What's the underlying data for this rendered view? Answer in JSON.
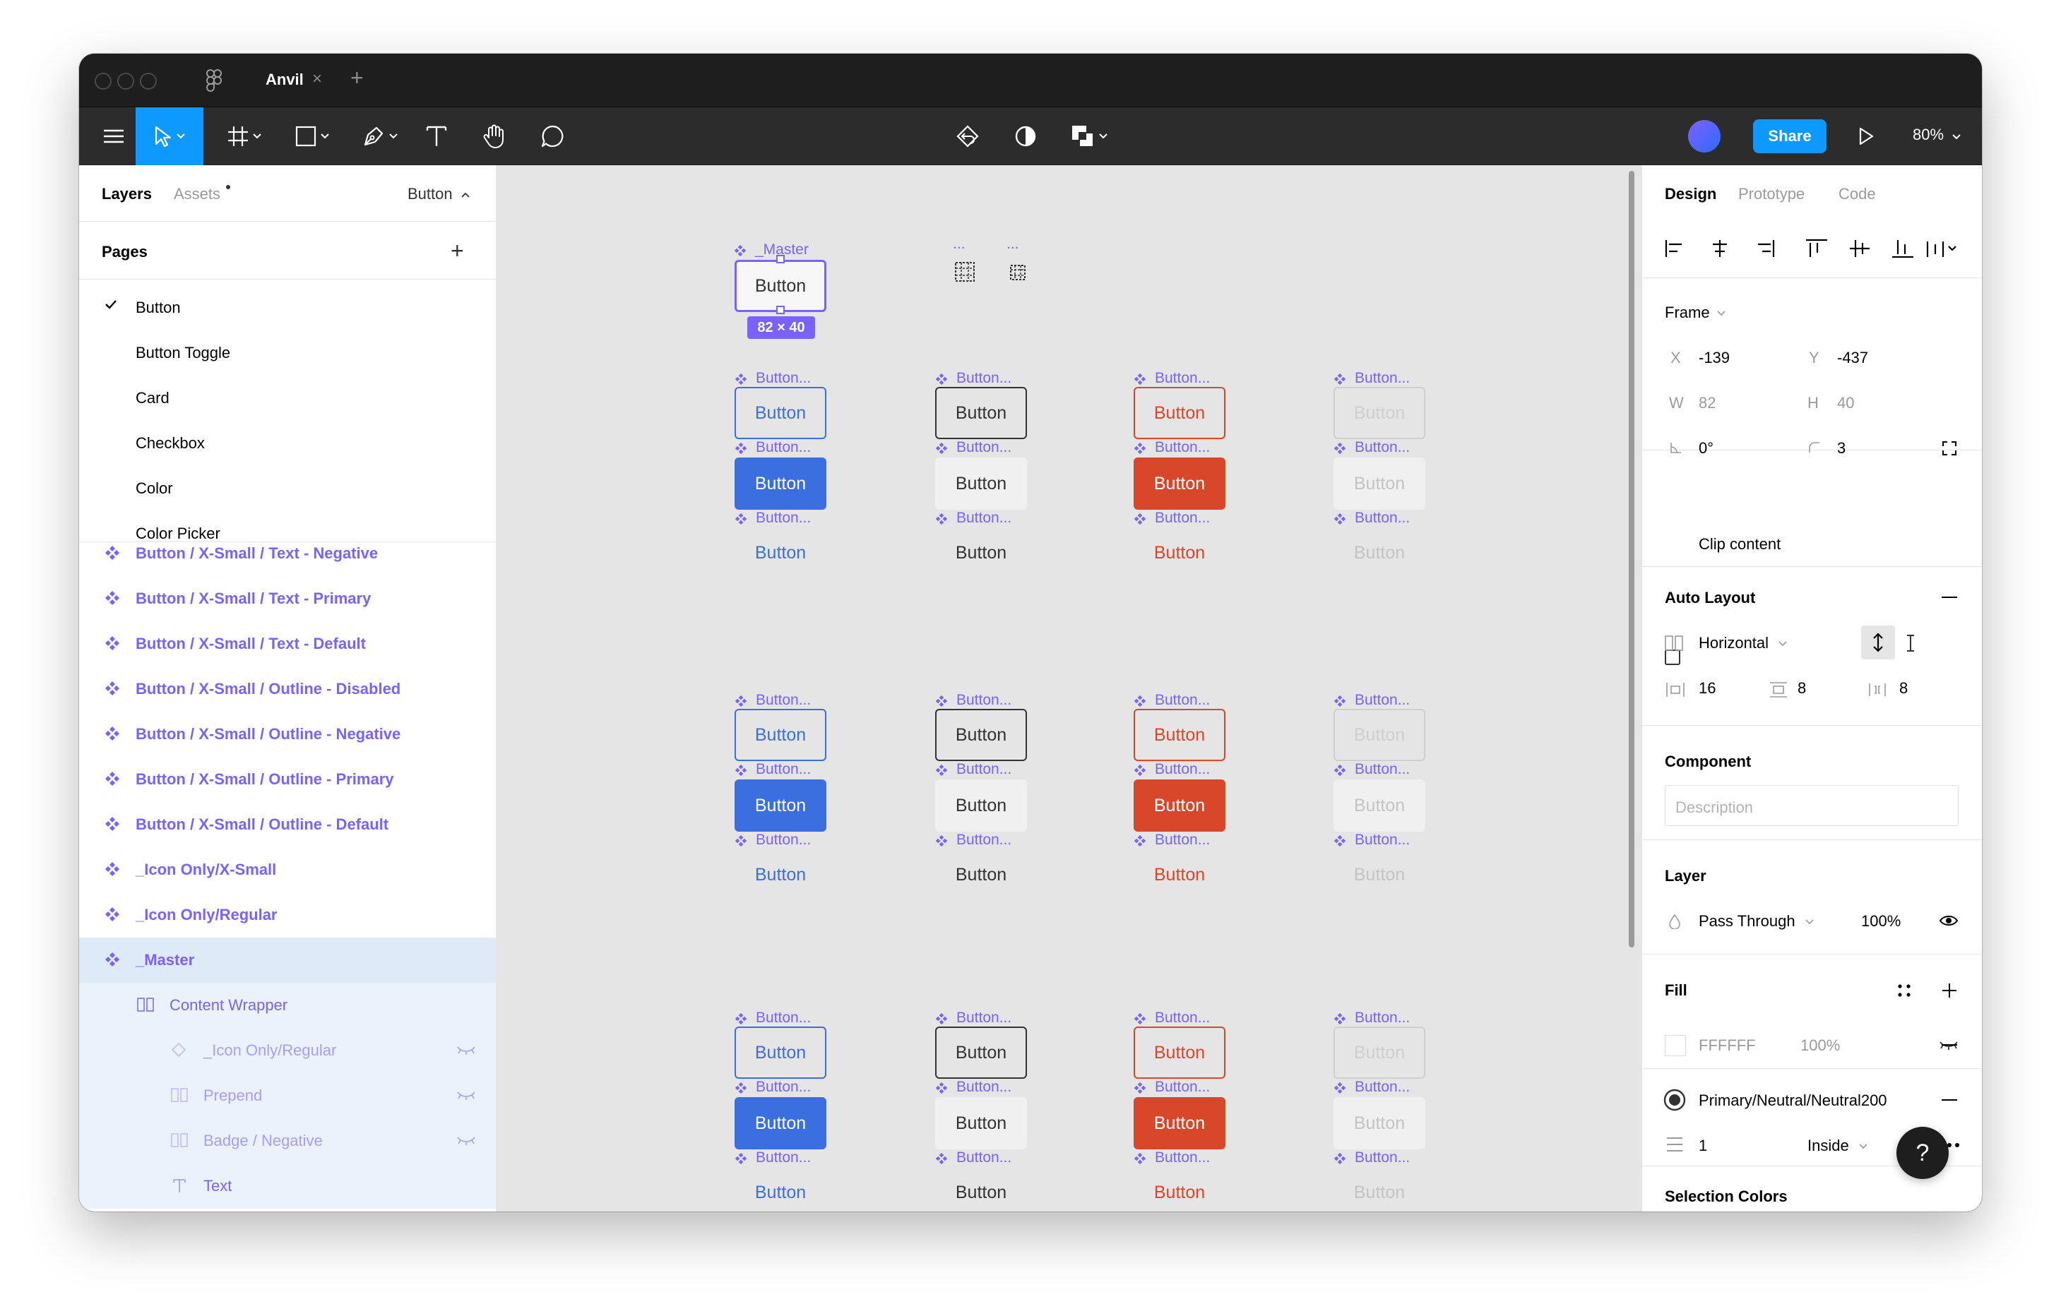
{
  "window": {
    "tab_title": "Anvil",
    "tab_close": "×",
    "new_tab": "+"
  },
  "toolbar": {
    "share_label": "Share",
    "zoom": "80%",
    "icons": [
      "menu-icon",
      "move-icon",
      "frame-icon",
      "rectangle-icon",
      "pen-icon",
      "text-icon",
      "hand-icon",
      "comment-icon",
      "component-icon",
      "contrast-icon",
      "boolean-icon",
      "play-icon"
    ]
  },
  "left_panel": {
    "tab_layers": "Layers",
    "tab_assets": "Assets",
    "current_page": "Button",
    "pages_title": "Pages",
    "pages": [
      "Button",
      "Button Toggle",
      "Card",
      "Checkbox",
      "Color",
      "Color Picker"
    ],
    "selected_page": "Button",
    "layers": [
      {
        "name": "Button / X-Small / Text - Negative",
        "kind": "component"
      },
      {
        "name": "Button / X-Small / Text - Primary",
        "kind": "component"
      },
      {
        "name": "Button / X-Small / Text - Default",
        "kind": "component"
      },
      {
        "name": "Button / X-Small / Outline - Disabled",
        "kind": "component"
      },
      {
        "name": "Button / X-Small / Outline - Negative",
        "kind": "component"
      },
      {
        "name": "Button / X-Small / Outline - Primary",
        "kind": "component"
      },
      {
        "name": "Button / X-Small / Outline - Default",
        "kind": "component"
      },
      {
        "name": "_Icon Only/X-Small",
        "kind": "component"
      },
      {
        "name": "_Icon Only/Regular",
        "kind": "component"
      },
      {
        "name": "_Master",
        "kind": "component-selected"
      },
      {
        "name": "Content Wrapper",
        "kind": "frame-child"
      },
      {
        "name": "_Icon Only/Regular",
        "kind": "instance-hidden"
      },
      {
        "name": "Prepend",
        "kind": "frame-hidden"
      },
      {
        "name": "Badge / Negative",
        "kind": "frame-hidden"
      },
      {
        "name": "Text",
        "kind": "text-child"
      }
    ]
  },
  "canvas": {
    "master_label": "_Master",
    "master_button": "Button",
    "size_badge": "82 × 40",
    "dots": "...",
    "truncated_label": "Button...",
    "button_text": "Button",
    "colors": {
      "primary": "#3b6fe0",
      "neutral": "#333333",
      "negative": "#d9472b",
      "disabled": "#c4c4c4",
      "purple": "#7b61ff"
    }
  },
  "right_panel": {
    "tab_design": "Design",
    "tab_prototype": "Prototype",
    "tab_code": "Code",
    "frame_label": "Frame",
    "x_label": "X",
    "x_value": "-139",
    "y_label": "Y",
    "y_value": "-437",
    "w_label": "W",
    "w_value": "82",
    "h_label": "H",
    "h_value": "40",
    "rotation": "0°",
    "radius": "3",
    "clip_content": "Clip content",
    "auto_layout": "Auto Layout",
    "direction": "Horizontal",
    "padding_h": "16",
    "padding_v": "8",
    "gap": "8",
    "component": "Component",
    "description_placeholder": "Description",
    "layer": "Layer",
    "blend": "Pass Through",
    "opacity": "100%",
    "fill": "Fill",
    "fill_hex": "FFFFFF",
    "fill_opacity": "100%",
    "stroke_style": "Primary/Neutral/Neutral200",
    "stroke_weight": "1",
    "stroke_align": "Inside",
    "selection_colors": "Selection Colors",
    "help": "?"
  }
}
